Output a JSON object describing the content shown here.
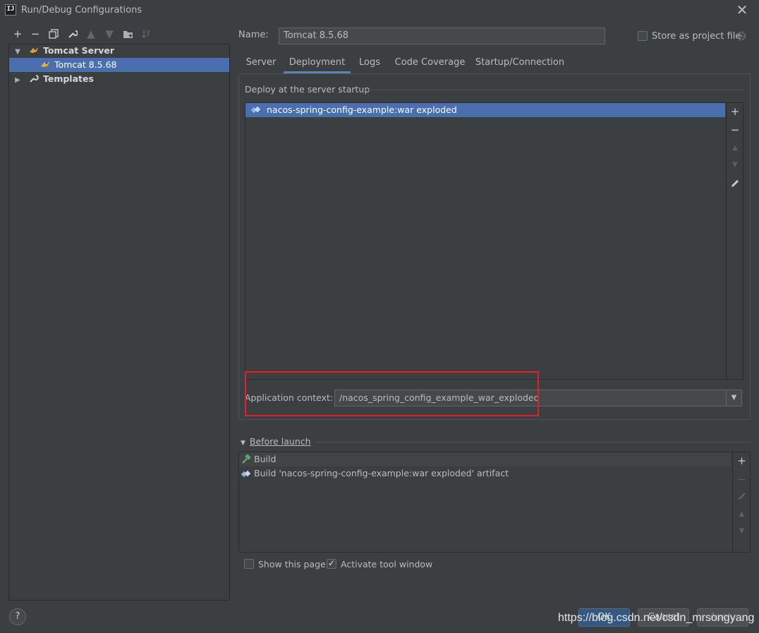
{
  "window": {
    "title": "Run/Debug Configurations",
    "app_icon_text": "IJ"
  },
  "toolbar": {
    "icons": [
      "add-icon",
      "remove-icon",
      "copy-icon",
      "wrench-icon",
      "move-up-icon",
      "move-down-icon",
      "new-folder-icon",
      "sort-icon"
    ]
  },
  "tree": {
    "group_label": "Tomcat Server",
    "item_label": "Tomcat 8.5.68",
    "templates_label": "Templates"
  },
  "form": {
    "name_label": "Name:",
    "name_value": "Tomcat 8.5.68",
    "store_label": "Store as project file",
    "store_checked": false
  },
  "tabs": [
    {
      "label": "Server"
    },
    {
      "label": "Deployment"
    },
    {
      "label": "Logs"
    },
    {
      "label": "Code Coverage"
    },
    {
      "label": "Startup/Connection"
    }
  ],
  "active_tab": "Deployment",
  "deployment": {
    "group_title": "Deploy at the server startup",
    "artifact": "nacos-spring-config-example:war exploded",
    "context_label": "Application context:",
    "context_value": "/nacos_spring_config_example_war_exploded"
  },
  "before_launch": {
    "title": "Before launch",
    "items": [
      {
        "label": "Build",
        "icon": "hammer-icon"
      },
      {
        "label": "Build 'nacos-spring-config-example:war exploded' artifact",
        "icon": "artifact-icon"
      }
    ]
  },
  "options": {
    "show_page_label": "Show this page",
    "show_page_checked": false,
    "activate_label": "Activate tool window",
    "activate_checked": true
  },
  "buttons": {
    "ok": "OK",
    "cancel": "Cancel",
    "apply": "Apply",
    "help": "?"
  },
  "watermark": "https://blog.csdn.net/csdn_mrsongyang",
  "colors": {
    "selection": "#4b6eaf",
    "accent": "#4a88c7",
    "highlight": "#e0202a",
    "background": "#3c3f41"
  }
}
